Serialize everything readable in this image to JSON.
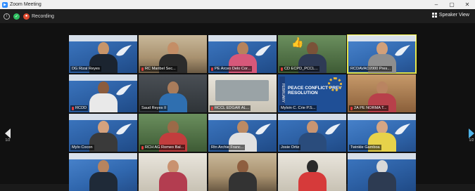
{
  "window": {
    "title": "Zoom Meeting",
    "controls": [
      "–",
      "▢",
      "✕"
    ]
  },
  "toolbar": {
    "recording_label": "Recording",
    "speaker_view_label": "Speaker View"
  },
  "pagination": {
    "left": "1/2",
    "right": "1/2"
  },
  "tiles": [
    {
      "name": "DG Rizal Reyes",
      "muted": false
    },
    {
      "name": "RC Maribel Sec...",
      "muted": true
    },
    {
      "name": "PE Arceo Delo Cor...",
      "muted": true
    },
    {
      "name": "CD ECPD_PCCL...",
      "muted": true
    },
    {
      "name": "RCDAVAO2000 Pres...",
      "muted": false
    },
    {
      "name": "RCDD",
      "muted": true
    },
    {
      "name": "Saud Reyes II",
      "muted": false
    },
    {
      "name": "RCCL EDGAR AL...",
      "muted": true
    },
    {
      "name": "Mylvin C. Crie P.S...",
      "muted": false
    },
    {
      "name": "2A PE NORMA T...",
      "muted": true
    },
    {
      "name": "Mylo Cocon",
      "muted": false
    },
    {
      "name": "RCH AG Romeo Bal...",
      "muted": true
    },
    {
      "name": "Rtn Archie Franc...",
      "muted": false
    },
    {
      "name": "Josie Ortiz",
      "muted": false
    },
    {
      "name": "Twinkle Gamboa",
      "muted": false
    },
    {
      "name": "",
      "muted": false
    },
    {
      "name": "",
      "muted": false
    },
    {
      "name": "",
      "muted": false
    },
    {
      "name": "",
      "muted": false
    },
    {
      "name": "",
      "muted": false
    }
  ],
  "banner_text": {
    "peace": "PEACE CONFLICT PREV RESOLUTION",
    "feb": "FEBRUARY"
  },
  "colors": {
    "active_border": "#e6e64a",
    "recording": "#e04a2f",
    "rotary_blue": "#2c5fa3"
  }
}
